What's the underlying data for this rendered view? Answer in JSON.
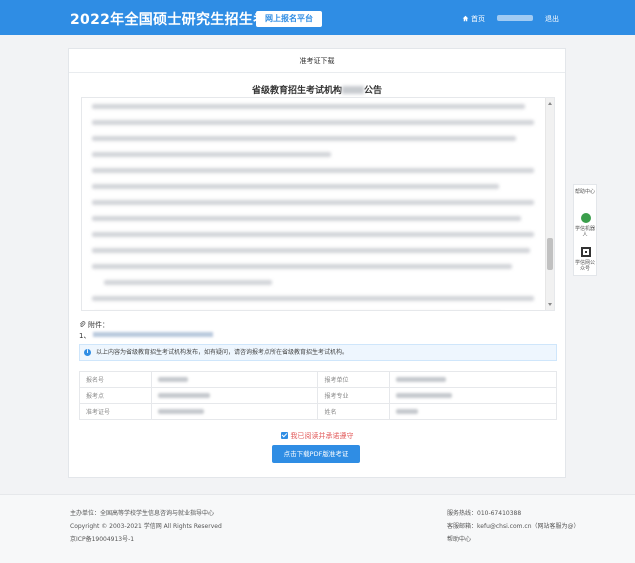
{
  "header": {
    "brand": "2022年全国硕士研究生招生考试",
    "platform": "网上报名平台",
    "home": "首页",
    "logout": "退出"
  },
  "card": {
    "title": "准考证下载",
    "announcement_title": "省级教育招生考试机构",
    "announcement_suffix": "公告",
    "attachment_label": "附件：",
    "attachment_index": "1、",
    "notice": "以上内容为省级教育招生考试机构发布，如有疑问，请咨询报考点所在省级教育招生考试机构。",
    "table": {
      "row1": {
        "l1": "报名号",
        "l2": "报考单位"
      },
      "row2": {
        "l1": "报考点",
        "l2": "报考专业"
      },
      "row3": {
        "l1": "准考证号",
        "l2": "姓名"
      }
    },
    "agree": "我已阅读并承诺遵守",
    "download_button": "点击下载PDF版准考证"
  },
  "side_panel": {
    "help": "帮助中心",
    "robot": "学信机器人",
    "wechat": "学信网公众号"
  },
  "footer": {
    "sponsor": "主办单位：全国高等学校学生信息咨询与就业指导中心",
    "copyright": "Copyright © 2003-2021 学信网 All Rights Reserved",
    "icp": "京ICP备19004913号-1",
    "phone": "服务热线：010-67410388",
    "email": "客服邮箱：kefu@chsi.com.cn（网站客服为@）",
    "help": "帮助中心"
  },
  "colors": {
    "header_bg": "#2f8de4",
    "button_bg": "#2f8de4",
    "agree_text": "#e25b5b"
  }
}
